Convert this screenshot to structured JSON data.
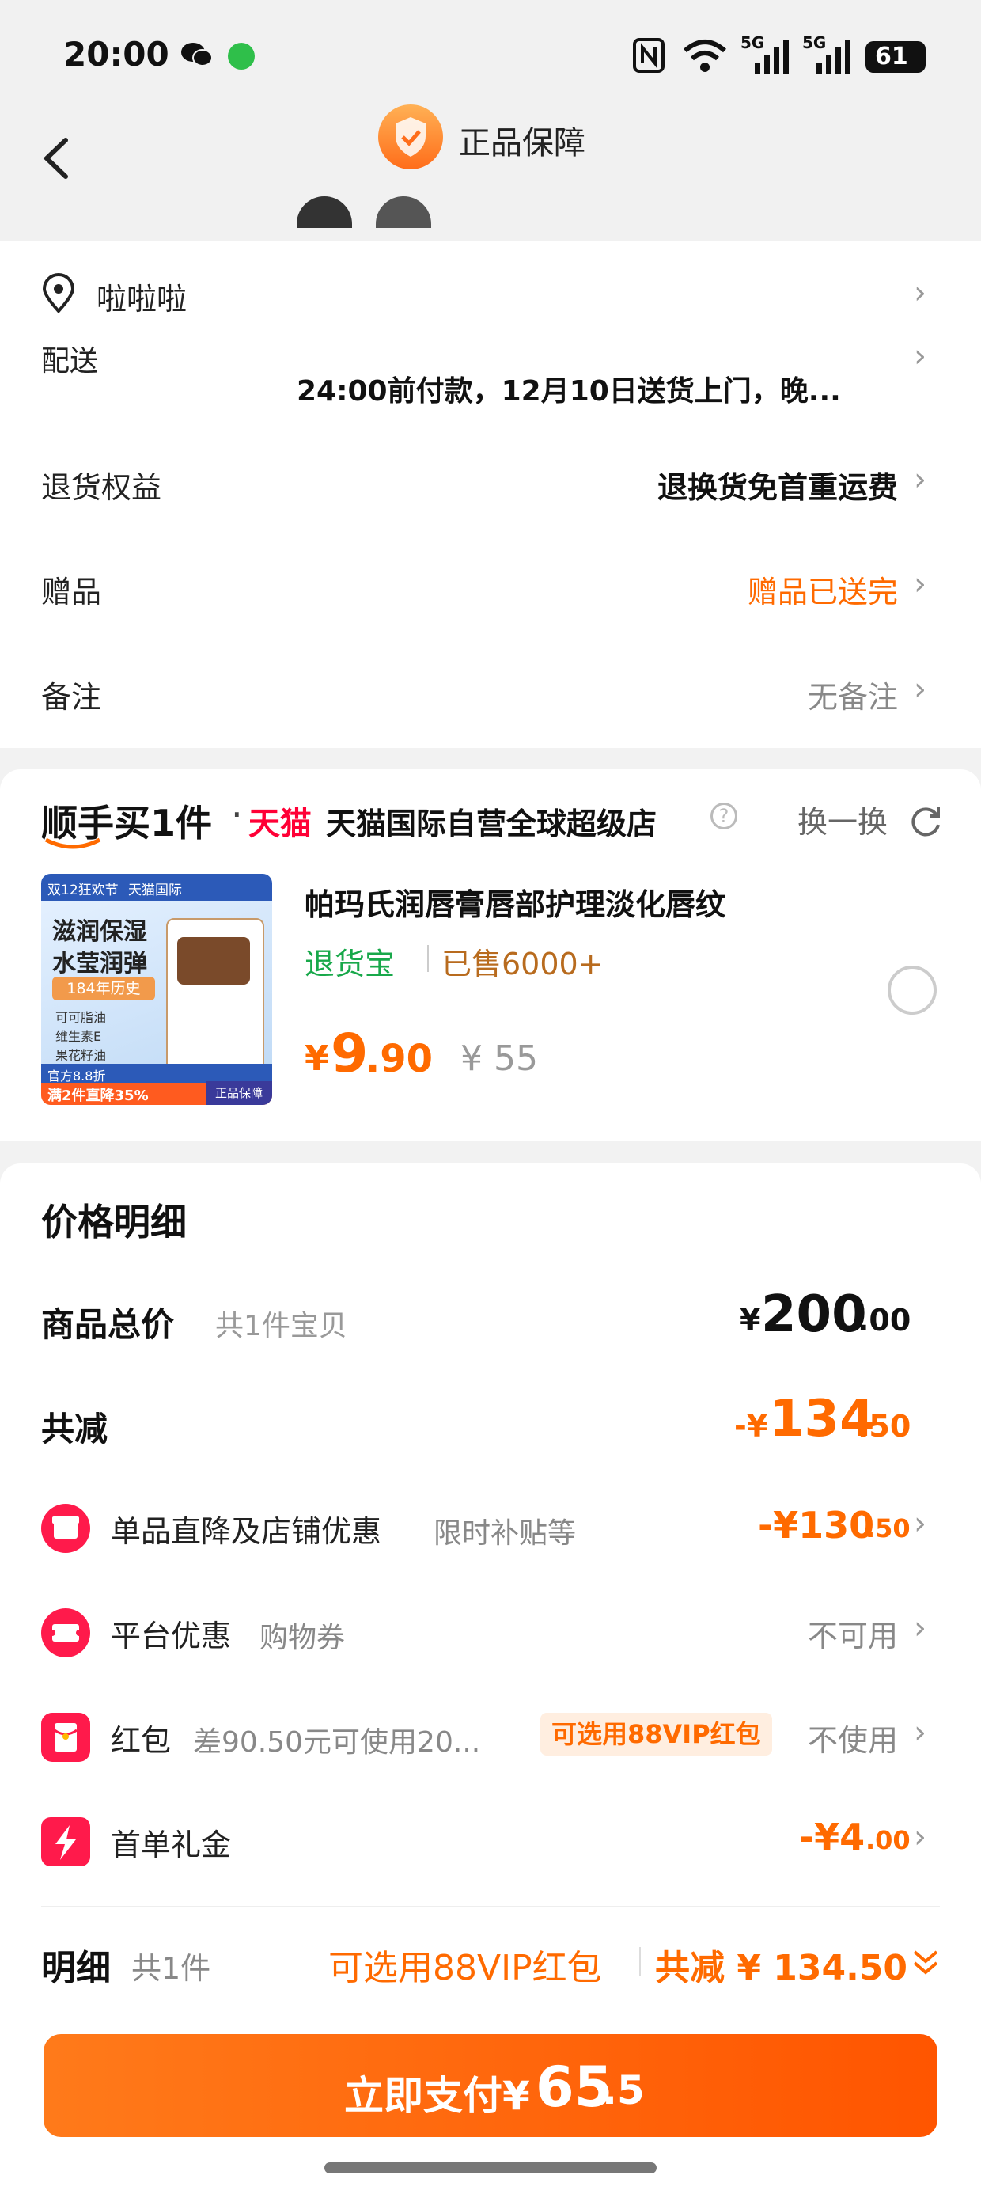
{
  "status": {
    "time": "20:00",
    "battery": "61",
    "network_a": "5G",
    "network_b": "5G"
  },
  "header": {
    "title": "正品保障"
  },
  "address": {
    "name": "啦啦啦"
  },
  "delivery": {
    "label": "配送",
    "value": "24:00前付款，12月10日送货上门，晚..."
  },
  "returns": {
    "label": "退货权益",
    "value": "退换货免首重运费"
  },
  "gift": {
    "label": "赠品",
    "value": "赠品已送完"
  },
  "note": {
    "label": "备注",
    "value": "无备注"
  },
  "addon": {
    "title_part1": "顺手买1件",
    "brand": "天猫",
    "store": "天猫国际自营全球超级店",
    "help": "?",
    "swap": "换一换",
    "product": {
      "name": "帕玛氏润唇膏唇部护理淡化唇纹",
      "tag_return": "退货宝",
      "sold": "已售6000+",
      "price_symbol": "¥",
      "price_int": "9",
      "price_dec": ".90",
      "orig_price": "¥ 55",
      "img_top_left": "双12狂欢节",
      "img_top_mid": "天猫国际",
      "img_line1": "滋润保湿",
      "img_line2": "水莹润弹",
      "img_badge": "184年历史",
      "img_item1": "可可脂油",
      "img_item2": "维生素E",
      "img_item3": "果花籽油",
      "img_bottom1": "官方8.8折",
      "img_bottom2": "满2件直降35%",
      "img_corner": "正品保障"
    }
  },
  "price_detail": {
    "title": "价格明细",
    "total_label": "商品总价",
    "total_sub": "共1件宝贝",
    "total_sym": "¥",
    "total_int": "200",
    "total_dec": ".00",
    "discount_label": "共减",
    "discount_sym": "-¥",
    "discount_int": "134",
    "discount_dec": ".50",
    "items": [
      {
        "label": "单品直降及店铺优惠",
        "sub": "限时补贴等",
        "value": "-¥130",
        "value_dec": ".50"
      },
      {
        "label": "平台优惠",
        "sub": "购物券",
        "value": "不可用",
        "value_dec": ""
      },
      {
        "label": "红包",
        "sub": "差90.50元可使用20...",
        "tag": "可选用88VIP红包",
        "value": "不使用",
        "value_dec": ""
      },
      {
        "label": "首单礼金",
        "sub": "",
        "value": "-¥4",
        "value_dec": ".00"
      }
    ]
  },
  "summary": {
    "label": "明细",
    "count": "共1件",
    "vip": "可选用88VIP红包",
    "total_discount": "共减 ¥ 134.50"
  },
  "pay": {
    "label": "立即支付¥",
    "amount_int": "65",
    "amount_dec": ".5"
  }
}
